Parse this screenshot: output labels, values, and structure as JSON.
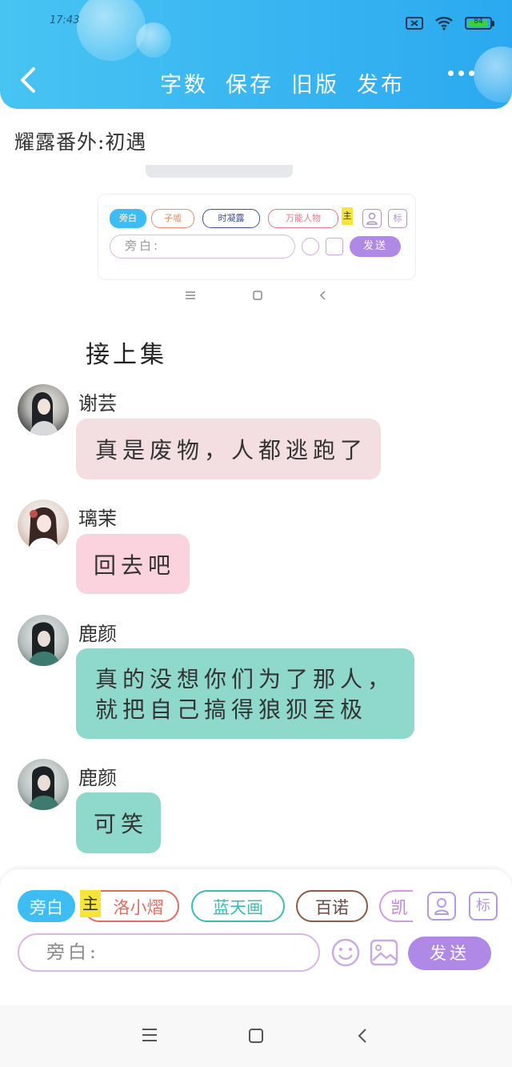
{
  "status_bar": {
    "time": "17:43",
    "battery_level": "84"
  },
  "header": {
    "actions": [
      "字数",
      "保存",
      "旧版",
      "发布"
    ],
    "accent": "#2ba9f0"
  },
  "document": {
    "title": "耀露番外:初遇",
    "embedded_screenshot": {
      "chips": [
        "旁白",
        "子墟",
        "时凝露",
        "万能人物"
      ],
      "main_badge": "主",
      "mark_label": "标",
      "input_placeholder": "旁白:",
      "send_label": "发送"
    },
    "continuation": "接上集"
  },
  "messages": [
    {
      "name": "谢芸",
      "lines": [
        "真是废物，人都逃跑了"
      ],
      "bubble_color": "#f3dfe1"
    },
    {
      "name": "璃茉",
      "lines": [
        "回去吧"
      ],
      "bubble_color": "#fad3de"
    },
    {
      "name": "鹿颜",
      "lines": [
        "真的没想你们为了那人，",
        "就把自己搞得狼狈至极"
      ],
      "bubble_color": "#8fd8cc"
    },
    {
      "name": "鹿颜",
      "lines": [
        "可笑"
      ],
      "bubble_color": "#8fd8cc"
    }
  ],
  "input_bar": {
    "chips": [
      {
        "label": "旁白",
        "color": "#3dbdf2"
      },
      {
        "label": "洛小熠",
        "color": "#e26b63"
      },
      {
        "label": "蓝天画",
        "color": "#3cbdb0"
      },
      {
        "label": "百诺",
        "color": "#8b5a48"
      },
      {
        "label": "凯",
        "color": "#d59ae6"
      }
    ],
    "main_badge": "主",
    "mark_label": "标",
    "placeholder": "旁白:",
    "send_label": "发送"
  }
}
